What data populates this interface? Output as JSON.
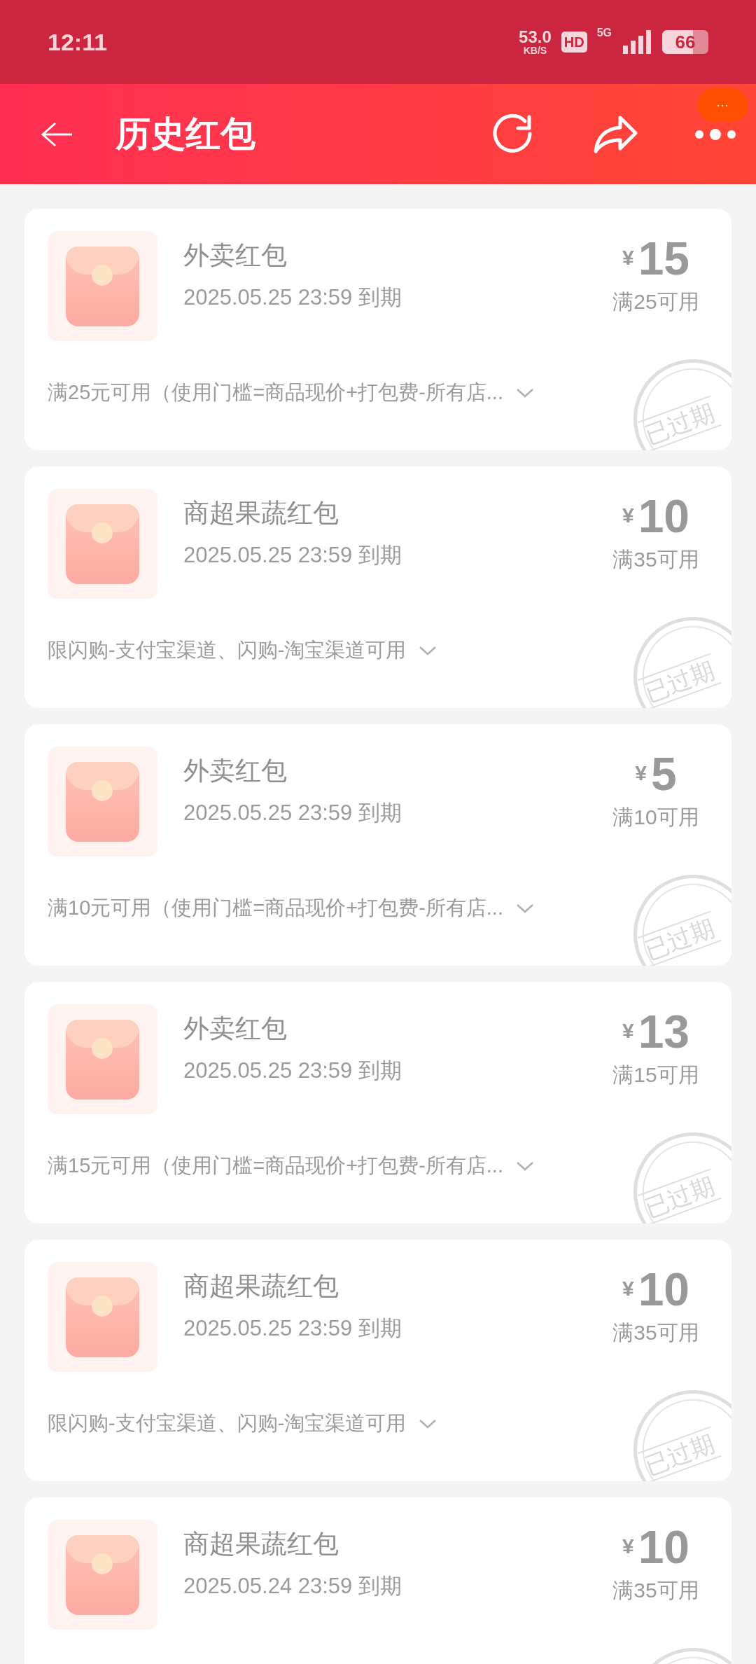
{
  "status_bar": {
    "time": "12:11",
    "speed": "53.0",
    "speed_unit": "KB/S",
    "hd": "HD",
    "network": "5G",
    "battery": "66"
  },
  "header": {
    "title": "历史红包",
    "badge": "···"
  },
  "coupons": [
    {
      "title": "外卖红包",
      "expiry": "2025.05.25 23:59 到期",
      "currency": "¥",
      "amount": "15",
      "condition": "满25可用",
      "description": "满25元可用（使用门槛=商品现价+打包费-所有店...",
      "expired": true,
      "stamp_text": "已过期"
    },
    {
      "title": "商超果蔬红包",
      "expiry": "2025.05.25 23:59 到期",
      "currency": "¥",
      "amount": "10",
      "condition": "满35可用",
      "description": "限闪购-支付宝渠道、闪购-淘宝渠道可用",
      "expired": true,
      "stamp_text": "已过期"
    },
    {
      "title": "外卖红包",
      "expiry": "2025.05.25 23:59 到期",
      "currency": "¥",
      "amount": "5",
      "condition": "满10可用",
      "description": "满10元可用（使用门槛=商品现价+打包费-所有店...",
      "expired": true,
      "stamp_text": "已过期"
    },
    {
      "title": "外卖红包",
      "expiry": "2025.05.25 23:59 到期",
      "currency": "¥",
      "amount": "13",
      "condition": "满15可用",
      "description": "满15元可用（使用门槛=商品现价+打包费-所有店...",
      "expired": true,
      "stamp_text": "已过期"
    },
    {
      "title": "商超果蔬红包",
      "expiry": "2025.05.25 23:59 到期",
      "currency": "¥",
      "amount": "10",
      "condition": "满35可用",
      "description": "限闪购-支付宝渠道、闪购-淘宝渠道可用",
      "expired": true,
      "stamp_text": "已过期"
    },
    {
      "title": "商超果蔬红包",
      "expiry": "2025.05.24 23:59 到期",
      "currency": "¥",
      "amount": "10",
      "condition": "满35可用",
      "expired": true
    }
  ]
}
